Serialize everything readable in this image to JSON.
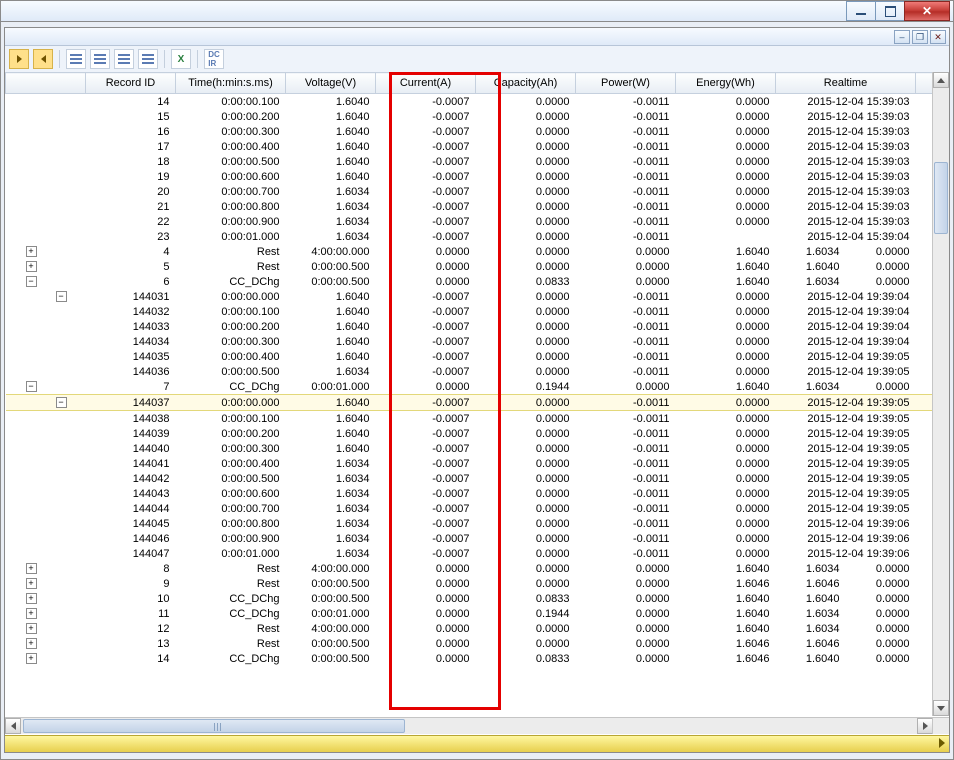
{
  "columns": {
    "record_id": "Record ID",
    "time": "Time(h:min:s.ms)",
    "voltage": "Voltage(V)",
    "current": "Current(A)",
    "capacity": "Capacity(Ah)",
    "power": "Power(W)",
    "energy": "Energy(Wh)",
    "realtime": "Realtime"
  },
  "rows": [
    {
      "type": "data",
      "id": "14",
      "time": "0:00:00.100",
      "volt": "1.6040",
      "curr": "-0.0007",
      "cap": "0.0000",
      "pow": "-0.0011",
      "ener": "0.0000",
      "real": "2015-12-04 15:39:03"
    },
    {
      "type": "data",
      "id": "15",
      "time": "0:00:00.200",
      "volt": "1.6040",
      "curr": "-0.0007",
      "cap": "0.0000",
      "pow": "-0.0011",
      "ener": "0.0000",
      "real": "2015-12-04 15:39:03"
    },
    {
      "type": "data",
      "id": "16",
      "time": "0:00:00.300",
      "volt": "1.6040",
      "curr": "-0.0007",
      "cap": "0.0000",
      "pow": "-0.0011",
      "ener": "0.0000",
      "real": "2015-12-04 15:39:03"
    },
    {
      "type": "data",
      "id": "17",
      "time": "0:00:00.400",
      "volt": "1.6040",
      "curr": "-0.0007",
      "cap": "0.0000",
      "pow": "-0.0011",
      "ener": "0.0000",
      "real": "2015-12-04 15:39:03"
    },
    {
      "type": "data",
      "id": "18",
      "time": "0:00:00.500",
      "volt": "1.6040",
      "curr": "-0.0007",
      "cap": "0.0000",
      "pow": "-0.0011",
      "ener": "0.0000",
      "real": "2015-12-04 15:39:03"
    },
    {
      "type": "data",
      "id": "19",
      "time": "0:00:00.600",
      "volt": "1.6040",
      "curr": "-0.0007",
      "cap": "0.0000",
      "pow": "-0.0011",
      "ener": "0.0000",
      "real": "2015-12-04 15:39:03"
    },
    {
      "type": "data",
      "id": "20",
      "time": "0:00:00.700",
      "volt": "1.6034",
      "curr": "-0.0007",
      "cap": "0.0000",
      "pow": "-0.0011",
      "ener": "0.0000",
      "real": "2015-12-04 15:39:03"
    },
    {
      "type": "data",
      "id": "21",
      "time": "0:00:00.800",
      "volt": "1.6034",
      "curr": "-0.0007",
      "cap": "0.0000",
      "pow": "-0.0011",
      "ener": "0.0000",
      "real": "2015-12-04 15:39:03"
    },
    {
      "type": "data",
      "id": "22",
      "time": "0:00:00.900",
      "volt": "1.6034",
      "curr": "-0.0007",
      "cap": "0.0000",
      "pow": "-0.0011",
      "ener": "0.0000",
      "real": "2015-12-04 15:39:03"
    },
    {
      "type": "data",
      "id": "23",
      "time": "0:00:01.000",
      "volt": "1.6034",
      "curr": "-0.0007",
      "cap": "0.0000",
      "pow": "-0.0011",
      "ener": "",
      "real": "2015-12-04 15:39:04"
    },
    {
      "type": "step",
      "exp": "+",
      "indent": 0,
      "id": "4",
      "label": "Rest",
      "time": "4:00:00.000",
      "curr": "0.0000",
      "cap": "0.0000",
      "pow": "0.0000",
      "ener": "1.6040",
      "extra1": "1.6034",
      "real": "0.0000",
      "extra2": "0"
    },
    {
      "type": "step",
      "exp": "+",
      "indent": 0,
      "id": "5",
      "label": "Rest",
      "time": "0:00:00.500",
      "curr": "0.0000",
      "cap": "0.0000",
      "pow": "0.0000",
      "ener": "1.6040",
      "extra1": "1.6040",
      "real": "0.0000",
      "extra2": "0"
    },
    {
      "type": "step",
      "exp": "-",
      "indent": 0,
      "id": "6",
      "label": "CC_DChg",
      "time": "0:00:00.500",
      "curr": "0.0000",
      "cap": "0.0833",
      "pow": "0.0000",
      "ener": "1.6040",
      "extra1": "1.6034",
      "real": "0.0000",
      "extra2": "1"
    },
    {
      "type": "data",
      "exp": "-",
      "indent": 1,
      "id": "144031",
      "time": "0:00:00.000",
      "volt": "1.6040",
      "curr": "-0.0007",
      "cap": "0.0000",
      "pow": "-0.0011",
      "ener": "0.0000",
      "real": "2015-12-04 19:39:04"
    },
    {
      "type": "data",
      "id": "144032",
      "time": "0:00:00.100",
      "volt": "1.6040",
      "curr": "-0.0007",
      "cap": "0.0000",
      "pow": "-0.0011",
      "ener": "0.0000",
      "real": "2015-12-04 19:39:04"
    },
    {
      "type": "data",
      "id": "144033",
      "time": "0:00:00.200",
      "volt": "1.6040",
      "curr": "-0.0007",
      "cap": "0.0000",
      "pow": "-0.0011",
      "ener": "0.0000",
      "real": "2015-12-04 19:39:04"
    },
    {
      "type": "data",
      "id": "144034",
      "time": "0:00:00.300",
      "volt": "1.6040",
      "curr": "-0.0007",
      "cap": "0.0000",
      "pow": "-0.0011",
      "ener": "0.0000",
      "real": "2015-12-04 19:39:04"
    },
    {
      "type": "data",
      "id": "144035",
      "time": "0:00:00.400",
      "volt": "1.6040",
      "curr": "-0.0007",
      "cap": "0.0000",
      "pow": "-0.0011",
      "ener": "0.0000",
      "real": "2015-12-04 19:39:05"
    },
    {
      "type": "data",
      "id": "144036",
      "time": "0:00:00.500",
      "volt": "1.6034",
      "curr": "-0.0007",
      "cap": "0.0000",
      "pow": "-0.0011",
      "ener": "0.0000",
      "real": "2015-12-04 19:39:05"
    },
    {
      "type": "step",
      "exp": "-",
      "indent": 0,
      "id": "7",
      "label": "CC_DChg",
      "time": "0:00:01.000",
      "curr": "0.0000",
      "cap": "0.1944",
      "pow": "0.0000",
      "ener": "1.6040",
      "extra1": "1.6034",
      "real": "0.0000",
      "extra2": "1"
    },
    {
      "type": "data",
      "highlight": true,
      "exp": "-",
      "indent": 1,
      "id": "144037",
      "time": "0:00:00.000",
      "volt": "1.6040",
      "curr": "-0.0007",
      "cap": "0.0000",
      "pow": "-0.0011",
      "ener": "0.0000",
      "real": "2015-12-04 19:39:05"
    },
    {
      "type": "data",
      "id": "144038",
      "time": "0:00:00.100",
      "volt": "1.6040",
      "curr": "-0.0007",
      "cap": "0.0000",
      "pow": "-0.0011",
      "ener": "0.0000",
      "real": "2015-12-04 19:39:05"
    },
    {
      "type": "data",
      "id": "144039",
      "time": "0:00:00.200",
      "volt": "1.6040",
      "curr": "-0.0007",
      "cap": "0.0000",
      "pow": "-0.0011",
      "ener": "0.0000",
      "real": "2015-12-04 19:39:05"
    },
    {
      "type": "data",
      "id": "144040",
      "time": "0:00:00.300",
      "volt": "1.6040",
      "curr": "-0.0007",
      "cap": "0.0000",
      "pow": "-0.0011",
      "ener": "0.0000",
      "real": "2015-12-04 19:39:05"
    },
    {
      "type": "data",
      "id": "144041",
      "time": "0:00:00.400",
      "volt": "1.6034",
      "curr": "-0.0007",
      "cap": "0.0000",
      "pow": "-0.0011",
      "ener": "0.0000",
      "real": "2015-12-04 19:39:05"
    },
    {
      "type": "data",
      "id": "144042",
      "time": "0:00:00.500",
      "volt": "1.6034",
      "curr": "-0.0007",
      "cap": "0.0000",
      "pow": "-0.0011",
      "ener": "0.0000",
      "real": "2015-12-04 19:39:05"
    },
    {
      "type": "data",
      "id": "144043",
      "time": "0:00:00.600",
      "volt": "1.6034",
      "curr": "-0.0007",
      "cap": "0.0000",
      "pow": "-0.0011",
      "ener": "0.0000",
      "real": "2015-12-04 19:39:05"
    },
    {
      "type": "data",
      "id": "144044",
      "time": "0:00:00.700",
      "volt": "1.6034",
      "curr": "-0.0007",
      "cap": "0.0000",
      "pow": "-0.0011",
      "ener": "0.0000",
      "real": "2015-12-04 19:39:05"
    },
    {
      "type": "data",
      "id": "144045",
      "time": "0:00:00.800",
      "volt": "1.6034",
      "curr": "-0.0007",
      "cap": "0.0000",
      "pow": "-0.0011",
      "ener": "0.0000",
      "real": "2015-12-04 19:39:06"
    },
    {
      "type": "data",
      "id": "144046",
      "time": "0:00:00.900",
      "volt": "1.6034",
      "curr": "-0.0007",
      "cap": "0.0000",
      "pow": "-0.0011",
      "ener": "0.0000",
      "real": "2015-12-04 19:39:06"
    },
    {
      "type": "data",
      "id": "144047",
      "time": "0:00:01.000",
      "volt": "1.6034",
      "curr": "-0.0007",
      "cap": "0.0000",
      "pow": "-0.0011",
      "ener": "0.0000",
      "real": "2015-12-04 19:39:06"
    },
    {
      "type": "step",
      "exp": "+",
      "indent": 0,
      "id": "8",
      "label": "Rest",
      "time": "4:00:00.000",
      "curr": "0.0000",
      "cap": "0.0000",
      "pow": "0.0000",
      "ener": "1.6040",
      "extra1": "1.6034",
      "real": "0.0000",
      "extra2": "0"
    },
    {
      "type": "step",
      "exp": "+",
      "indent": 0,
      "id": "9",
      "label": "Rest",
      "time": "0:00:00.500",
      "curr": "0.0000",
      "cap": "0.0000",
      "pow": "0.0000",
      "ener": "1.6046",
      "extra1": "1.6046",
      "real": "0.0000",
      "extra2": "0"
    },
    {
      "type": "step",
      "exp": "+",
      "indent": 0,
      "id": "10",
      "label": "CC_DChg",
      "time": "0:00:00.500",
      "curr": "0.0000",
      "cap": "0.0833",
      "pow": "0.0000",
      "ener": "1.6040",
      "extra1": "1.6040",
      "real": "0.0000",
      "extra2": "1"
    },
    {
      "type": "step",
      "exp": "+",
      "indent": 0,
      "id": "11",
      "label": "CC_DChg",
      "time": "0:00:01.000",
      "curr": "0.0000",
      "cap": "0.1944",
      "pow": "0.0000",
      "ener": "1.6040",
      "extra1": "1.6034",
      "real": "0.0000",
      "extra2": "1"
    },
    {
      "type": "step",
      "exp": "+",
      "indent": 0,
      "id": "12",
      "label": "Rest",
      "time": "4:00:00.000",
      "curr": "0.0000",
      "cap": "0.0000",
      "pow": "0.0000",
      "ener": "1.6040",
      "extra1": "1.6034",
      "real": "0.0000",
      "extra2": "0"
    },
    {
      "type": "step",
      "exp": "+",
      "indent": 0,
      "id": "13",
      "label": "Rest",
      "time": "0:00:00.500",
      "curr": "0.0000",
      "cap": "0.0000",
      "pow": "0.0000",
      "ener": "1.6046",
      "extra1": "1.6046",
      "real": "0.0000",
      "extra2": "0"
    },
    {
      "type": "step",
      "exp": "+",
      "indent": 0,
      "id": "14",
      "label": "CC_DChg",
      "time": "0:00:00.500",
      "curr": "0.0000",
      "cap": "0.0833",
      "pow": "0.0000",
      "ener": "1.6046",
      "extra1": "1.6040",
      "real": "0.0000",
      "extra2": "1"
    }
  ]
}
